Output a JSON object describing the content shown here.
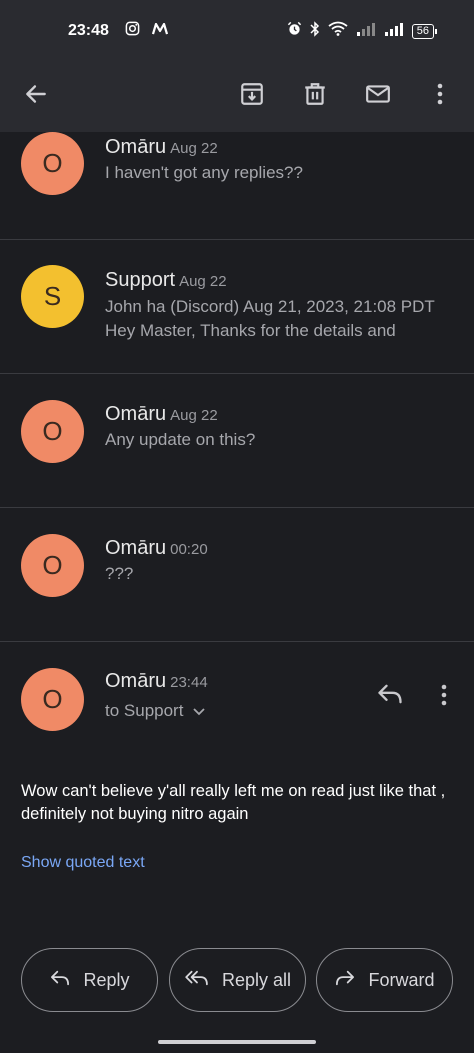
{
  "status": {
    "time": "23:48",
    "battery": "56"
  },
  "colors": {
    "avatar_orange": "#f08a66",
    "avatar_yellow": "#f3c02f",
    "link_blue": "#7aa7f5"
  },
  "icons": {
    "back": "arrow-left-icon",
    "archive": "archive-icon",
    "delete": "trash-icon",
    "mark_unread": "mail-icon",
    "more": "more-vert-icon"
  },
  "messages": [
    {
      "initial": "O",
      "sender": "Omāru",
      "date": "Aug 22",
      "snippet": "I haven't got any replies??"
    },
    {
      "initial": "S",
      "sender": "Support",
      "date": "Aug 22",
      "snippet": "John ha (Discord) Aug 21, 2023, 21:08 PDT",
      "snippet2": "Hey Master, Thanks for the details and"
    },
    {
      "initial": "O",
      "sender": "Omāru",
      "date": "Aug 22",
      "snippet": "Any update on this?"
    },
    {
      "initial": "O",
      "sender": "Omāru",
      "date": "00:20",
      "snippet": "???"
    }
  ],
  "expanded": {
    "initial": "O",
    "sender": "Omāru",
    "time": "23:44",
    "recipient": "to Support",
    "body": "Wow can't believe y'all really left me on read just like that , definitely not buying nitro again",
    "show_quoted": "Show quoted text"
  },
  "actions": {
    "reply": "Reply",
    "reply_all": "Reply all",
    "forward": "Forward"
  }
}
